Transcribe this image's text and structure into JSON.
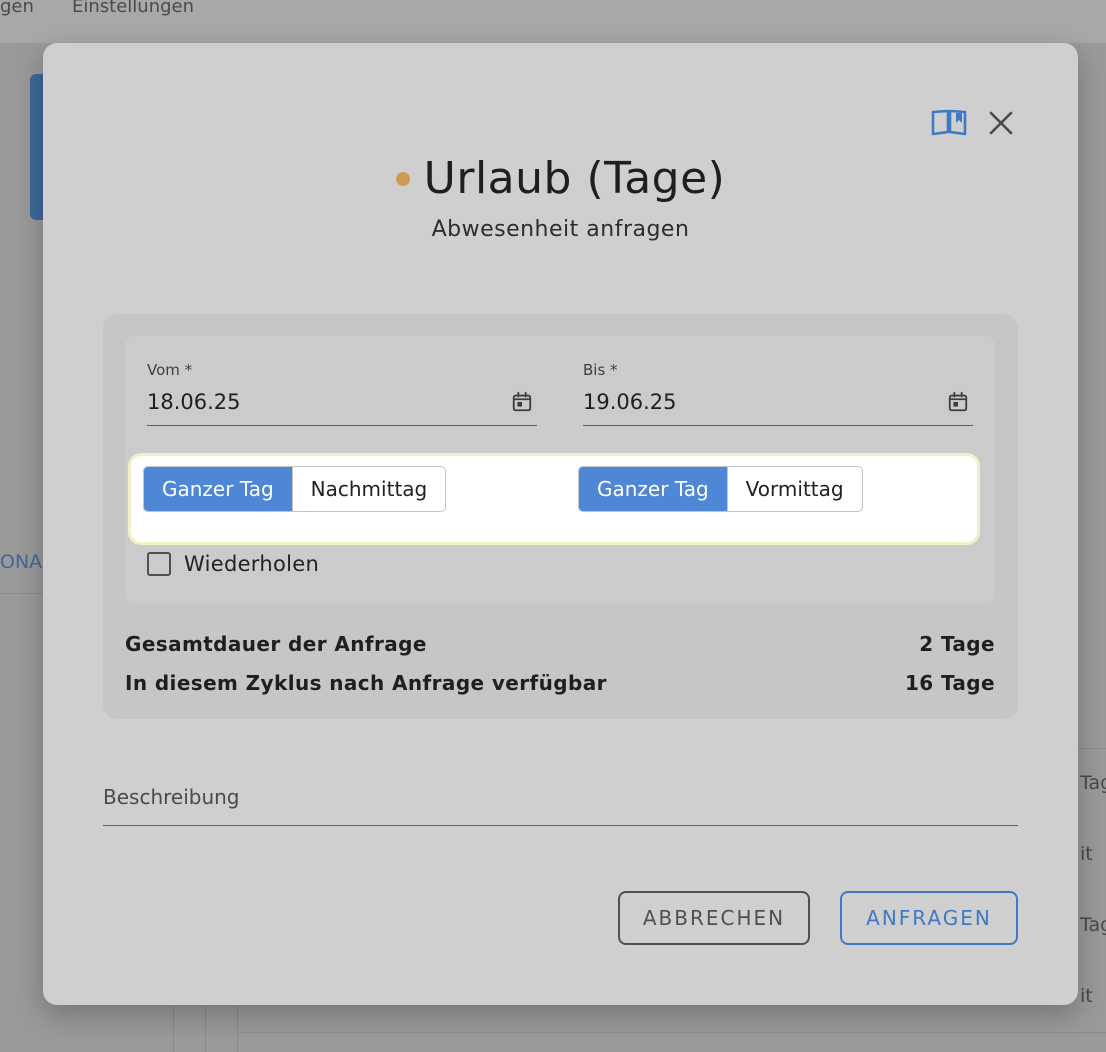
{
  "background": {
    "nav_partial": "gen",
    "nav_settings": "Einstellungen",
    "side_text": "ONA",
    "row_texts": [
      "Tag",
      "it",
      "Tag",
      "it"
    ]
  },
  "dialog": {
    "title": "Urlaub (Tage)",
    "subtitle": "Abwesenheit anfragen",
    "dot_color": "#cc9b55",
    "icons": {
      "guide": "book-open-icon",
      "close": "close-icon",
      "calendar": "calendar-icon"
    },
    "from": {
      "label": "Vom *",
      "value": "18.06.25",
      "options": [
        "Ganzer Tag",
        "Nachmittag"
      ],
      "selected": "Ganzer Tag"
    },
    "to": {
      "label": "Bis *",
      "value": "19.06.25",
      "options": [
        "Ganzer Tag",
        "Vormittag"
      ],
      "selected": "Ganzer Tag"
    },
    "repeat": {
      "label": "Wiederholen",
      "checked": false
    },
    "summary": [
      {
        "label": "Gesamtdauer der Anfrage",
        "value": "2 Tage"
      },
      {
        "label": "In diesem Zyklus nach Anfrage verfügbar",
        "value": "16 Tage"
      }
    ],
    "description": {
      "placeholder": "Beschreibung",
      "value": ""
    },
    "cancel_label": "ABBRECHEN",
    "submit_label": "ANFRAGEN",
    "accent_color": "#4d87d6"
  }
}
